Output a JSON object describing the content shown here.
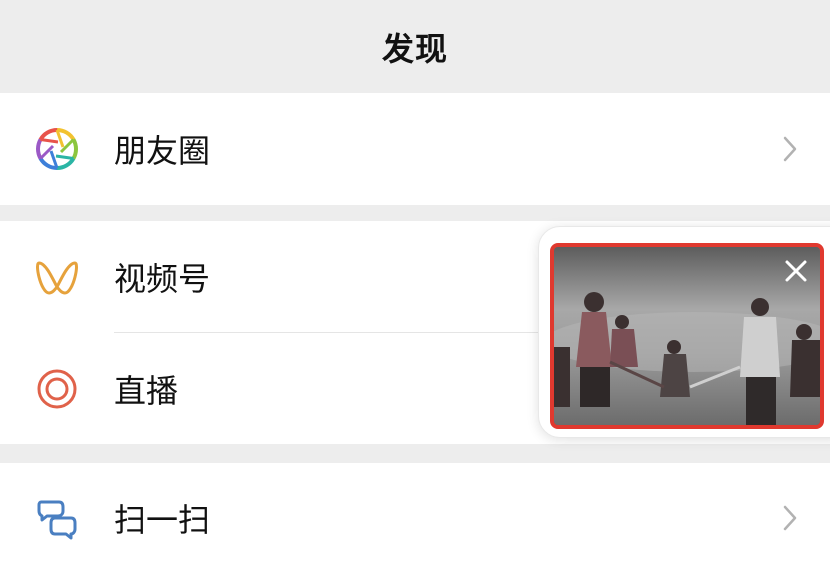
{
  "header": {
    "title": "发现"
  },
  "groups": [
    {
      "items": [
        {
          "label": "朋友圈",
          "icon": "moments-aperture-icon"
        }
      ]
    },
    {
      "items": [
        {
          "label": "视频号",
          "icon": "channels-butterfly-icon"
        },
        {
          "label": "直播",
          "icon": "live-ring-icon"
        }
      ]
    },
    {
      "items": [
        {
          "label": "扫一扫",
          "icon": "scan-icon"
        }
      ]
    }
  ],
  "floating_video": {
    "close_icon": "close-icon",
    "highlight_color": "#e0392f"
  },
  "colors": {
    "background": "#ededed",
    "card": "#ffffff",
    "text": "#111111",
    "chevron": "#b2b2b2",
    "channels_icon": "#e6a23c",
    "live_icon": "#e0624a",
    "scan_icon": "#4a7fc1"
  }
}
